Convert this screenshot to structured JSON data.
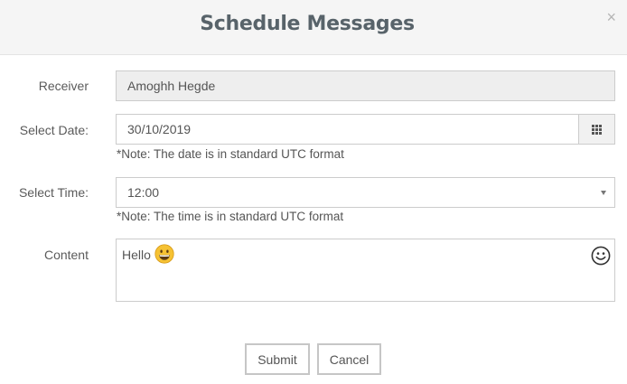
{
  "modal": {
    "title": "Schedule Messages",
    "close_label": "×"
  },
  "form": {
    "receiver": {
      "label": "Receiver",
      "value": "Amoghh Hegde"
    },
    "date": {
      "label": "Select Date:",
      "value": "30/10/2019",
      "note": "*Note: The date is in standard UTC format",
      "button_icon": "calendar-grid-icon"
    },
    "time": {
      "label": "Select Time:",
      "value": "12:00",
      "note": "*Note: The time is in standard UTC format"
    },
    "content": {
      "label": "Content",
      "value": "Hello",
      "inline_emoji": "grinning-face-emoji",
      "picker_icon": "smiley-icon"
    }
  },
  "buttons": {
    "submit": "Submit",
    "cancel": "Cancel"
  },
  "colors": {
    "header_bg": "#f5f5f5",
    "title": "#58636a",
    "emoji_yellow": "#f6c233",
    "border": "#cccccc"
  }
}
